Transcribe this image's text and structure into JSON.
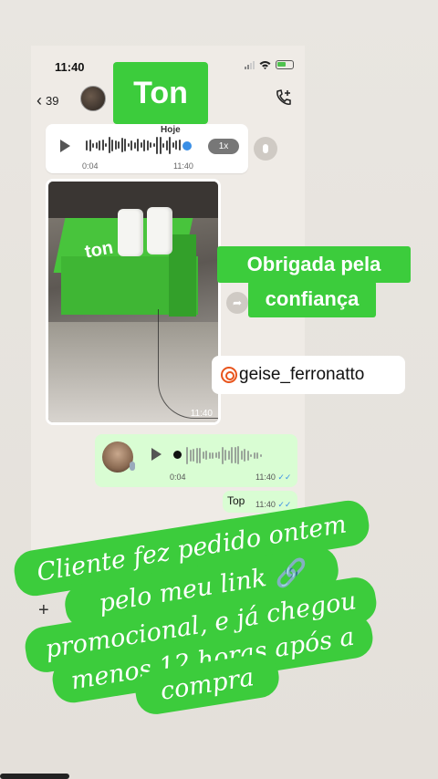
{
  "status": {
    "time": "11:40"
  },
  "header": {
    "back_count": "39",
    "contact_label": "Ton"
  },
  "audio1": {
    "date_label": "Hoje",
    "start": "0:04",
    "time": "11:40",
    "speed": "1x"
  },
  "photo": {
    "time": "11:40",
    "box_logo": "ton"
  },
  "overlay": {
    "thanks_line1": "Obrigada pela",
    "thanks_line2": "confiança",
    "handle": "geise_ferronatto"
  },
  "audio2": {
    "start": "0:04",
    "time": "11:40",
    "ticks": "✓✓"
  },
  "reply": {
    "text": "Top",
    "time": "11:40",
    "ticks": "✓✓"
  },
  "caption": {
    "line1": "Cliente fez pedido ontem",
    "line2": "pelo meu link 🔗",
    "line3": "promocional, e já chegou",
    "line4": "menos 12 horas após a",
    "line5": "compra"
  },
  "colors": {
    "accent_green": "#3ccc3c",
    "bubble_out": "#d9fdd3",
    "link_blue": "#3a8fe6"
  }
}
